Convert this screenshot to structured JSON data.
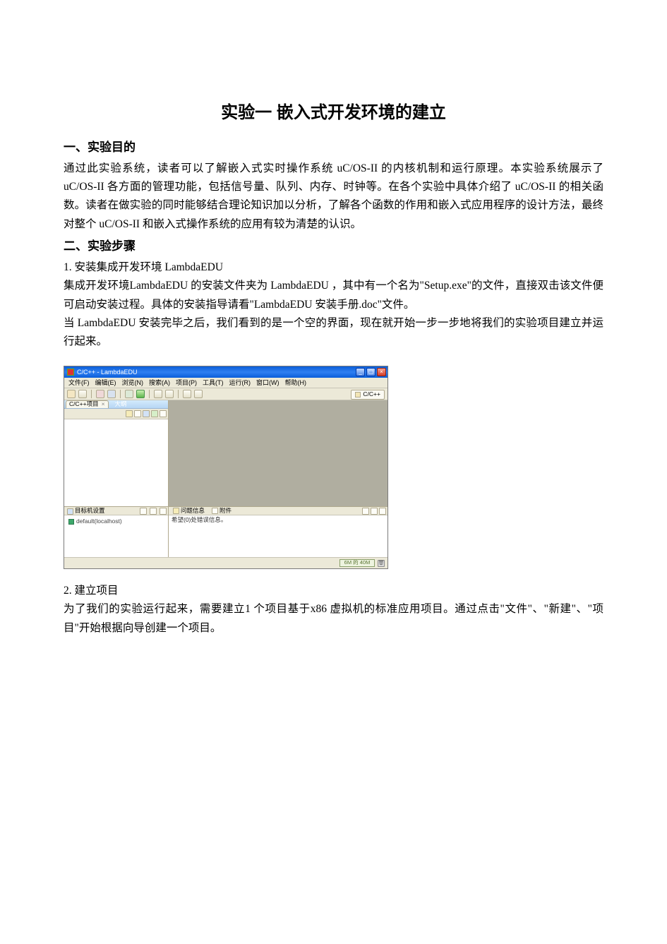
{
  "title": "实验一 嵌入式开发环境的建立",
  "section1": {
    "heading": "一、实验目的",
    "body": "通过此实验系统，读者可以了解嵌入式实时操作系统 uC/OS-II 的内核机制和运行原理。本实验系统展示了 uC/OS-II 各方面的管理功能，包括信号量、队列、内存、时钟等。在各个实验中具体介绍了 uC/OS-II 的相关函数。读者在做实验的同时能够结合理论知识加以分析，了解各个函数的作用和嵌入式应用程序的设计方法，最终对整个 uC/OS-II 和嵌入式操作系统的应用有较为清楚的认识。"
  },
  "section2": {
    "heading": "二、实验步骤",
    "step1_heading": "1. 安装集成开发环境 LambdaEDU",
    "step1_p1": "集成开发环境LambdaEDU 的安装文件夹为 LambdaEDU ，其中有一个名为\"Setup.exe\"的文件，直接双击该文件便可启动安装过程。具体的安装指导请看\"LambdaEDU 安装手册.doc\"文件。",
    "step1_p2": "当 LambdaEDU 安装完毕之后，我们看到的是一个空的界面，现在就开始一步一步地将我们的实验项目建立并运行起来。",
    "step2_heading": "2. 建立项目",
    "step2_p1": "为了我们的实验运行起来，需要建立1 个项目基于x86 虚拟机的标准应用项目。通过点击\"文件\"、\"新建\"、\"项目\"开始根据向导创建一个项目。"
  },
  "ide": {
    "window_title": "C/C++ - LambdaEDU",
    "menu": [
      "文件(F)",
      "编辑(E)",
      "浏览(N)",
      "搜索(A)",
      "项目(P)",
      "工具(T)",
      "运行(R)",
      "窗口(W)",
      "帮助(H)"
    ],
    "perspective": "C/C++",
    "left_tab_active": "C/C++项目",
    "left_tab_inactive": "大纲",
    "target_tab": "目标机设置",
    "target_item": "default(localhost)",
    "bottom_tab1": "问题信息",
    "bottom_tab2": "附件",
    "bottom_msg": "希望(0)处错误信息。",
    "mem": "6M 的 40M"
  }
}
